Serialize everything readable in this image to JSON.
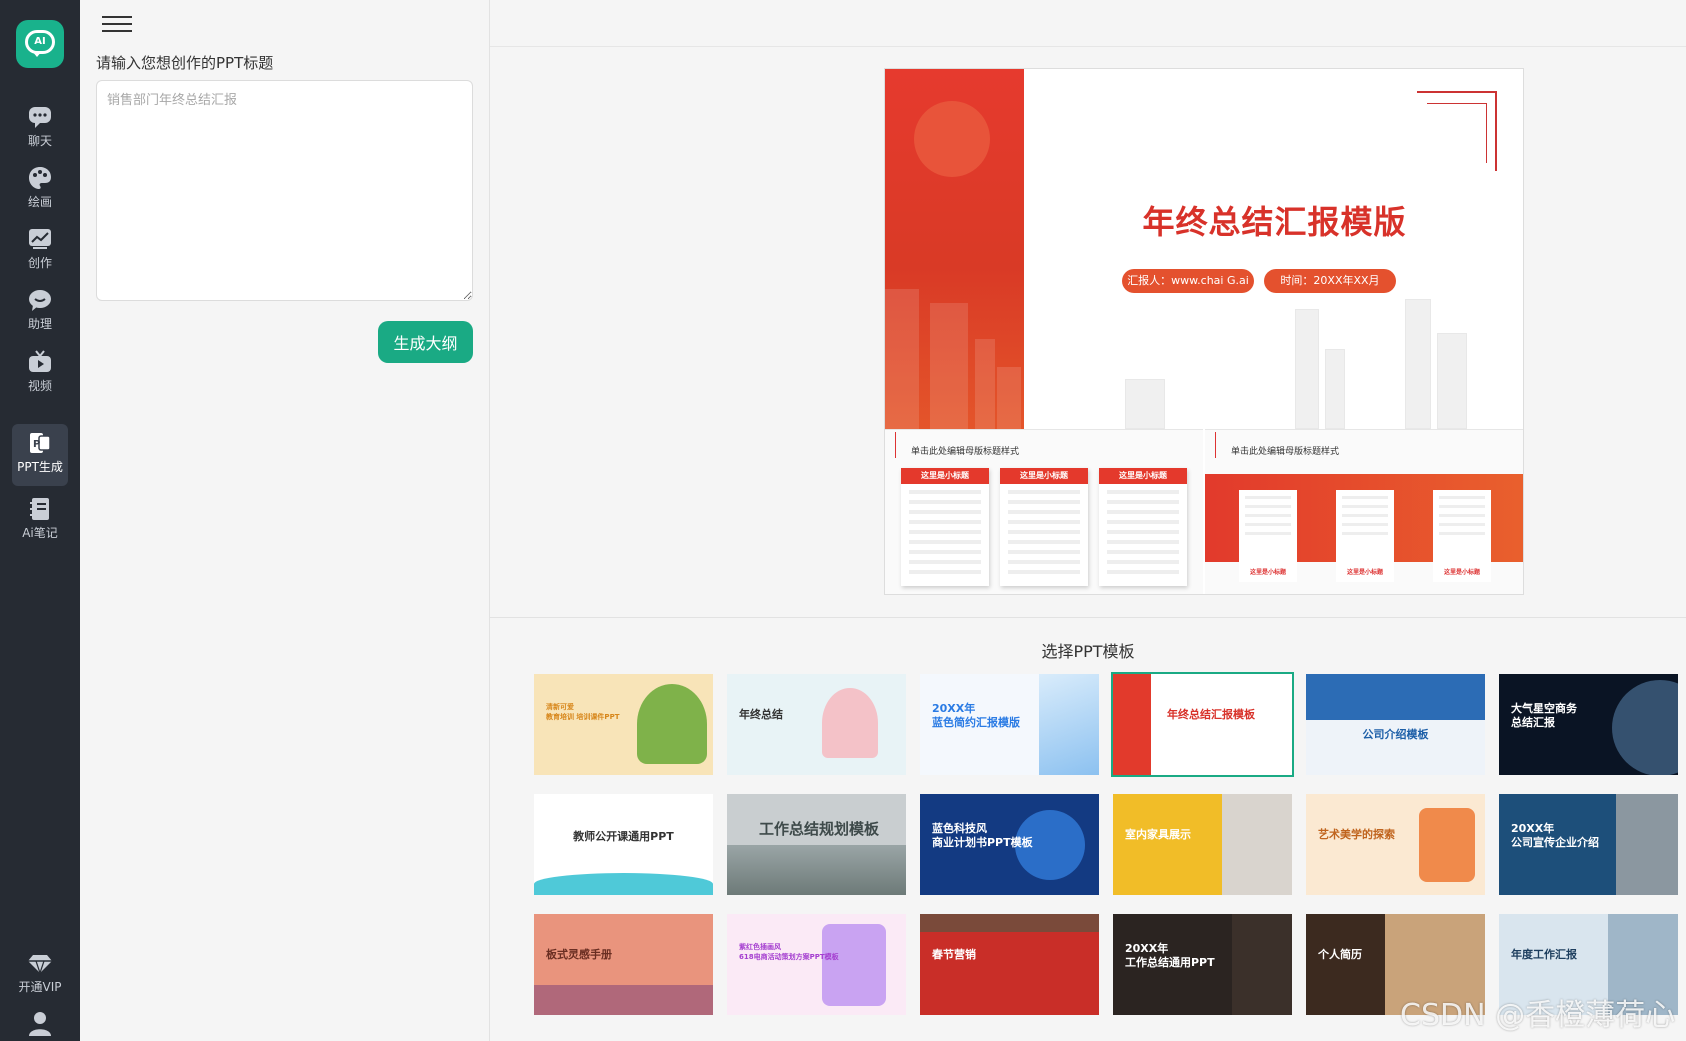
{
  "sidebar": {
    "logo_text": "AI",
    "items": [
      {
        "label": "聊天",
        "icon": "chat-bubble-icon"
      },
      {
        "label": "绘画",
        "icon": "palette-icon"
      },
      {
        "label": "创作",
        "icon": "chart-line-icon"
      },
      {
        "label": "助理",
        "icon": "assistant-bubble-icon"
      },
      {
        "label": "视频",
        "icon": "tv-icon"
      },
      {
        "label": "PPT生成",
        "icon": "ppt-icon",
        "active": true
      },
      {
        "label": "Ai笔记",
        "icon": "notebook-icon"
      },
      {
        "label": "开通VIP",
        "icon": "diamond-icon"
      }
    ],
    "profile_icon": "user-icon"
  },
  "form": {
    "label": "请输入您想创作的PPT标题",
    "placeholder": "销售部门年终总结汇报",
    "generate_button": "生成大纲"
  },
  "preview": {
    "title": "年终总结汇报模版",
    "reporter": "汇报人：www.chai G.ai",
    "time": "时间：20XX年XX月",
    "sub_title": "单击此处编辑母版标题样式",
    "card_heading": "这里是小标题",
    "band_card_label": "这里是小标题"
  },
  "templates": {
    "heading": "选择PPT模板",
    "items": [
      {
        "title": "清新可爱\n教育培训 培训课件PPT",
        "bg": "#f8e4b8",
        "fg": "#d7861a"
      },
      {
        "title": "年终总结",
        "bg": "#e8f3f6",
        "fg": "#333333"
      },
      {
        "title": "20XX年\n蓝色简约汇报模版",
        "bg": "#f4f8fd",
        "fg": "#2a7be4"
      },
      {
        "title": "年终总结汇报模板",
        "bg": "#ffffff",
        "fg": "#d8322a",
        "selected": true
      },
      {
        "title": "公司介绍模板",
        "bg": "#eef3f9",
        "fg": "#1d5fa8"
      },
      {
        "title": "大气星空商务\n总结汇报",
        "bg": "#0a1424",
        "fg": "#ffffff"
      },
      {
        "title": "教师公开课通用PPT",
        "bg": "#ffffff",
        "fg": "#333333"
      },
      {
        "title": "工作总结规划模板",
        "bg": "#c9ced0",
        "fg": "#ffffff"
      },
      {
        "title": "蓝色科技风\n商业计划书PPT模板",
        "bg": "#133a82",
        "fg": "#ffffff"
      },
      {
        "title": "室内家具展示",
        "bg": "#f1bd28",
        "fg": "#ffffff"
      },
      {
        "title": "艺术美学的探索",
        "bg": "#fbe9d2",
        "fg": "#c0641e"
      },
      {
        "title": "20XX年\n公司宣传企业介绍",
        "bg": "#1d4f7a",
        "fg": "#ffffff"
      },
      {
        "title": "板式灵感手册",
        "bg": "#e9947d",
        "fg": "#6a2e22"
      },
      {
        "title": "紫红色插画风\n618电商活动策划方案PPT模板",
        "bg": "#fbeaf6",
        "fg": "#a53fd0"
      },
      {
        "title": "春节营销",
        "bg": "#c92e28",
        "fg": "#ffffff"
      },
      {
        "title": "20XX年\n工作总结通用PPT",
        "bg": "#2b2421",
        "fg": "#ffffff"
      },
      {
        "title": "个人简历",
        "bg": "#3c2a1f",
        "fg": "#ffffff"
      },
      {
        "title": "年度工作汇报",
        "bg": "#d9e5ee",
        "fg": "#1d3e5e"
      }
    ]
  },
  "watermark": "CSDN @香橙薄荷心",
  "colors": {
    "accent": "#1aaa84",
    "sidebar_bg": "#262b33",
    "slide_red": "#d8322a"
  }
}
